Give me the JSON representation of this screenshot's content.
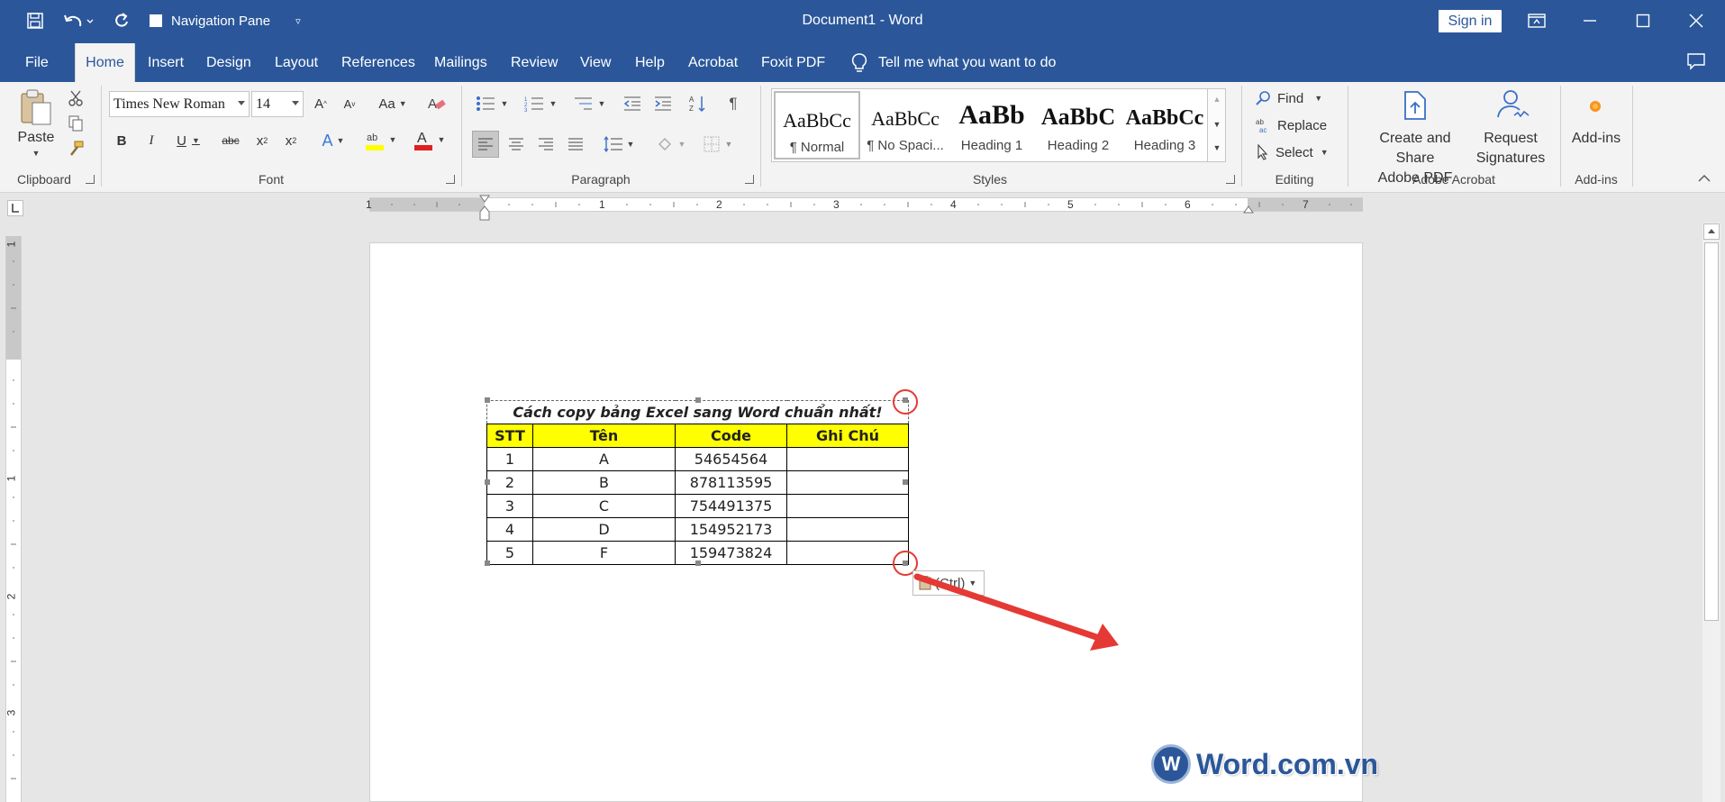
{
  "app": {
    "document_title": "Document1  -  Word",
    "sign_in": "Sign in",
    "navigation_pane": "Navigation Pane"
  },
  "tabs": [
    "File",
    "Home",
    "Insert",
    "Design",
    "Layout",
    "References",
    "Mailings",
    "Review",
    "View",
    "Help",
    "Acrobat",
    "Foxit PDF"
  ],
  "active_tab": "Home",
  "tell_me": "Tell me what you want to do",
  "ribbon": {
    "clipboard": {
      "paste": "Paste",
      "label": "Clipboard"
    },
    "font": {
      "name": "Times New Roman",
      "size": "14",
      "label": "Font"
    },
    "paragraph": {
      "label": "Paragraph"
    },
    "styles": {
      "label": "Styles",
      "items": [
        {
          "sample": "AaBbCc",
          "name": "¶ Normal"
        },
        {
          "sample": "AaBbCc",
          "name": "¶ No Spaci..."
        },
        {
          "sample": "AaBb",
          "name": "Heading 1"
        },
        {
          "sample": "AaBbC",
          "name": "Heading 2"
        },
        {
          "sample": "AaBbCc",
          "name": "Heading 3"
        }
      ]
    },
    "editing": {
      "label": "Editing",
      "find": "Find",
      "replace": "Replace",
      "select": "Select"
    },
    "acrobat": {
      "label": "Adobe Acrobat",
      "create_line1": "Create and Share",
      "create_line2": "Adobe PDF",
      "request_line1": "Request",
      "request_line2": "Signatures"
    },
    "addins": {
      "label": "Add-ins",
      "button": "Add-ins"
    }
  },
  "ruler": {
    "h_numbers": [
      "1",
      "1",
      "2",
      "3",
      "4",
      "5",
      "6",
      "7"
    ],
    "v_numbers": [
      "1",
      "1",
      "2",
      "3"
    ]
  },
  "table": {
    "title": "Cách copy bảng Excel sang Word chuẩn nhất!",
    "headers": [
      "STT",
      "Tên",
      "Code",
      "Ghi Chú"
    ],
    "rows": [
      [
        "1",
        "A",
        "54654564",
        ""
      ],
      [
        "2",
        "B",
        "878113595",
        ""
      ],
      [
        "3",
        "C",
        "754491375",
        ""
      ],
      [
        "4",
        "D",
        "154952173",
        ""
      ],
      [
        "5",
        "F",
        "159473824",
        ""
      ]
    ]
  },
  "paste_options": "(Ctrl)",
  "watermark": "Word.com.vn",
  "colors": {
    "word_blue": "#2b579a",
    "header_fill": "#ffff00",
    "annotation_red": "#e53935"
  }
}
